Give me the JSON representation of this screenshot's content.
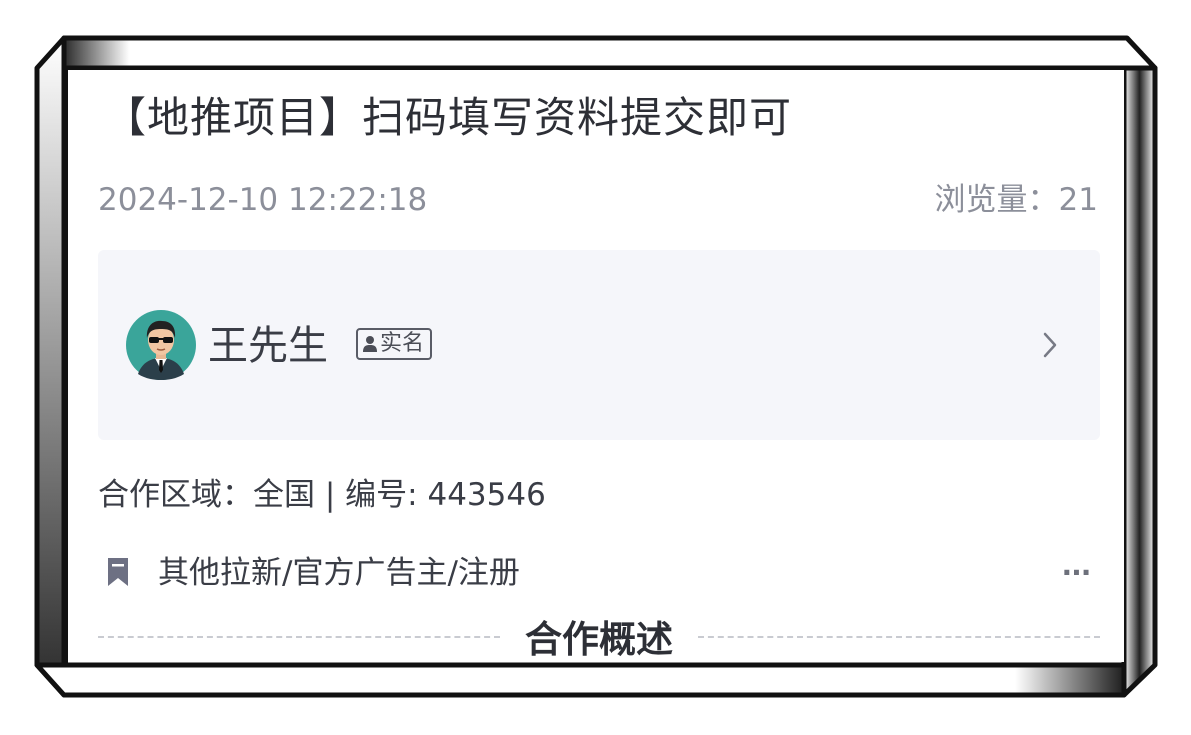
{
  "post": {
    "title": "【地推项目】扫码填写资料提交即可",
    "date": "2024-12-10 12:22:18",
    "views_label": "浏览量：",
    "views_count": "21"
  },
  "user": {
    "name": "王先生",
    "verified_label": "实名",
    "avatar_icon": "man-with-sunglasses-avatar"
  },
  "info": {
    "region_label": "合作区域：",
    "region_value": "全国",
    "separator": " | ",
    "number_label": "编号: ",
    "number_value": "443546"
  },
  "category": {
    "text": "其他拉新/官方广告主/注册",
    "icon": "bookmark-icon",
    "more_label": "···"
  },
  "section": {
    "title": "合作概述"
  },
  "colors": {
    "text_primary": "#2d2f36",
    "text_secondary": "#8c8f9a",
    "card_bg": "#f5f6fa",
    "avatar_bg": "#3aa59a"
  }
}
